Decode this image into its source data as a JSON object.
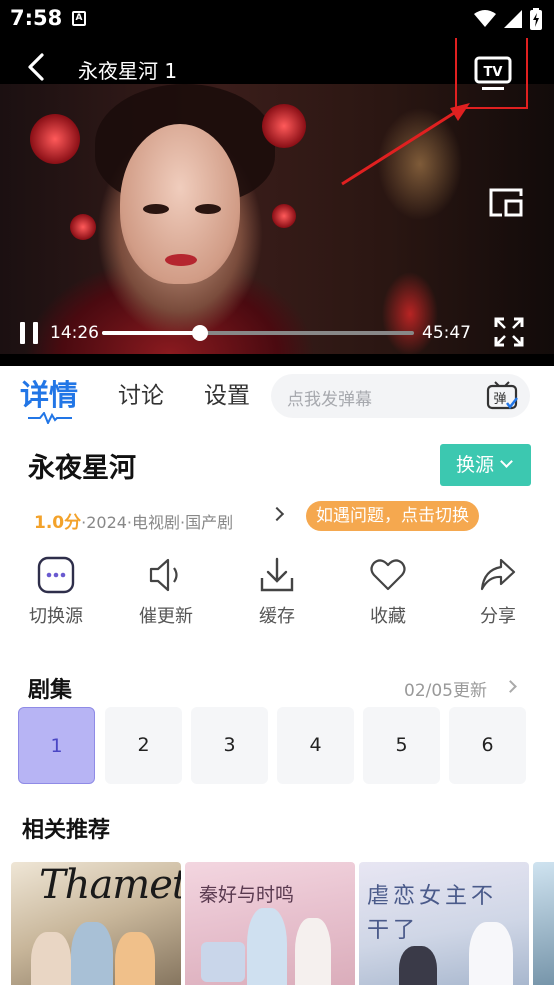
{
  "status": {
    "time": "7:58",
    "notif_letter": "A"
  },
  "player": {
    "title": "永夜星河 1",
    "current_time": "14:26",
    "total_time": "45:47",
    "progress_fraction": 0.315,
    "tv_label": "TV"
  },
  "tabs": {
    "items": [
      {
        "label": "详情"
      },
      {
        "label": "讨论"
      },
      {
        "label": "设置"
      }
    ],
    "danmu_placeholder": "点我发弹幕",
    "danmu_icon_label": "弹"
  },
  "info": {
    "title": "永夜星河",
    "source_button": "换源",
    "score": "1.0分",
    "meta_text": "·2024·电视剧·国产剧",
    "tip": "如遇问题，点击切换",
    "actions": [
      {
        "label": "切换源",
        "icon": "more-icon"
      },
      {
        "label": "催更新",
        "icon": "speaker-icon"
      },
      {
        "label": "缓存",
        "icon": "download-icon"
      },
      {
        "label": "收藏",
        "icon": "heart-icon"
      },
      {
        "label": "分享",
        "icon": "share-icon"
      }
    ]
  },
  "episodes": {
    "title": "剧集",
    "update_text": "02/05更新",
    "items": [
      "1",
      "2",
      "3",
      "4",
      "5",
      "6"
    ],
    "selected": "1"
  },
  "related": {
    "title": "相关推荐",
    "posters": [
      {
        "text": "Thameto"
      },
      {
        "text": "秦好与时鸣"
      },
      {
        "text": "虐恋女主不干了"
      }
    ]
  },
  "colors": {
    "accent": "#2276e6",
    "source_button": "#3cc8b0",
    "score": "#f3a22a",
    "tip": "#f5a84f",
    "episode_selected": "#b7b4f4",
    "highlight_box": "#e02020"
  }
}
